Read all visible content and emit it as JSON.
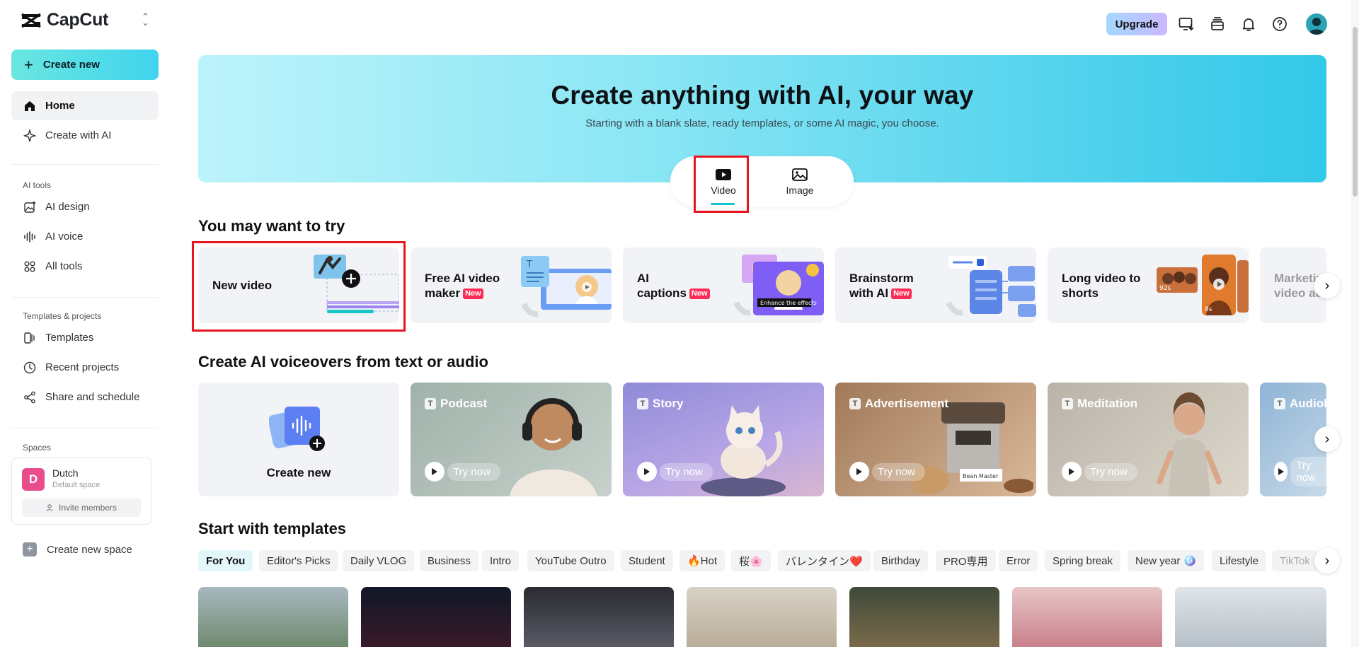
{
  "app": {
    "name": "CapCut"
  },
  "sidebar": {
    "create_new": "Create new",
    "home": "Home",
    "create_with_ai": "Create with AI",
    "ai_tools_label": "AI tools",
    "ai_design": "AI design",
    "ai_voice": "AI voice",
    "all_tools": "All tools",
    "templates_projects_label": "Templates & projects",
    "templates": "Templates",
    "recent_projects": "Recent projects",
    "share_schedule": "Share and schedule",
    "spaces_label": "Spaces",
    "space": {
      "initial": "D",
      "name": "Dutch",
      "subtitle": "Default space",
      "invite": "Invite members"
    },
    "create_new_space": "Create new space"
  },
  "topbar": {
    "upgrade": "Upgrade"
  },
  "hero": {
    "title": "Create anything with AI, your way",
    "subtitle": "Starting with a blank slate, ready templates, or some AI magic, you choose.",
    "modes": {
      "video": "Video",
      "image": "Image"
    }
  },
  "try_section": {
    "title": "You may want to try",
    "cards": [
      {
        "line1": "New video",
        "line2": "",
        "new": false
      },
      {
        "line1": "Free AI video",
        "line2": "maker",
        "new": true
      },
      {
        "line1": "AI",
        "line2": "captions",
        "new": true
      },
      {
        "line1": "Brainstorm",
        "line2": "with AI",
        "new": true
      },
      {
        "line1": "Long video to",
        "line2": "shorts",
        "new": false
      },
      {
        "line1": "Marketing",
        "line2": "video ads",
        "new": false
      }
    ],
    "badge": "New",
    "captions_overlay": "Enhance the effects",
    "shorts_durations": [
      "92s",
      "8s"
    ]
  },
  "voice_section": {
    "title": "Create AI voiceovers from text or audio",
    "create_new": "Create new",
    "try_now": "Try now",
    "cards": [
      "Podcast",
      "Story",
      "Advertisement",
      "Meditation",
      "Audiobook"
    ],
    "ad_machine_brand": "Bean Master"
  },
  "templates_section": {
    "title": "Start with templates",
    "chips": [
      "For You",
      "Editor's Picks",
      "Daily VLOG",
      "Business",
      "Intro",
      "YouTube Outro",
      "Student",
      "🔥Hot",
      "桜🌸",
      "バレンタイン❤️",
      "Birthday",
      "PRO専用",
      "Error",
      "Spring break",
      "New year 🪩",
      "Lifestyle",
      "TikTok"
    ]
  },
  "colors": {
    "accent": "#16c4d8",
    "highlight": "#e8141e",
    "new_badge": "#fe2c55"
  }
}
